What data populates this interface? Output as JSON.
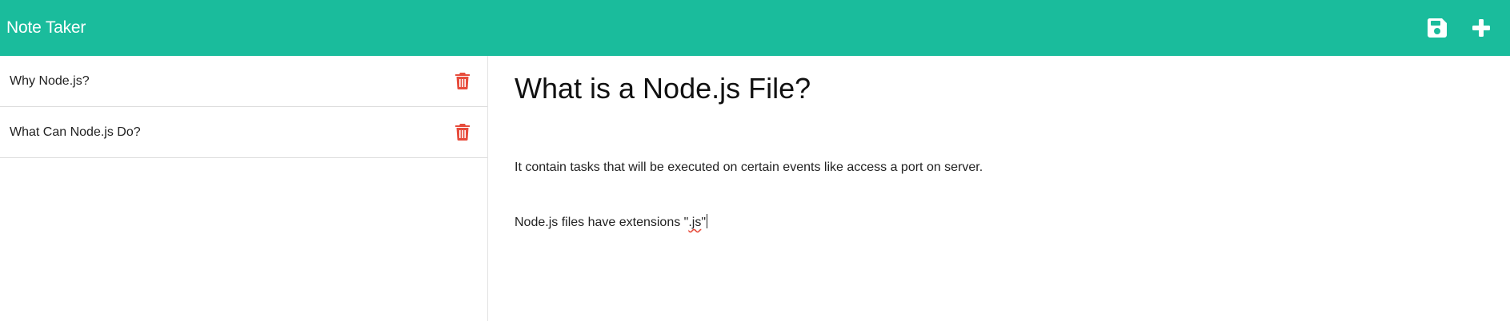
{
  "navbar": {
    "brand": "Note Taker",
    "save_icon": "floppy-disk-icon",
    "new_icon": "plus-icon",
    "bg_color": "#1abc9c"
  },
  "sidebar": {
    "notes": [
      {
        "title": "Why Node.js?",
        "delete_icon": "trash-icon"
      },
      {
        "title": "What Can Node.js Do?",
        "delete_icon": "trash-icon"
      }
    ],
    "delete_color": "#e74c3c"
  },
  "editor": {
    "title": "What is a Node.js File?",
    "body_line_1": "It contain tasks that will be executed on certain events like access a port on server.",
    "body_line_2_prefix": "Node.js files have extensions \"",
    "body_line_2_word": ".js",
    "body_line_2_suffix": "\""
  }
}
